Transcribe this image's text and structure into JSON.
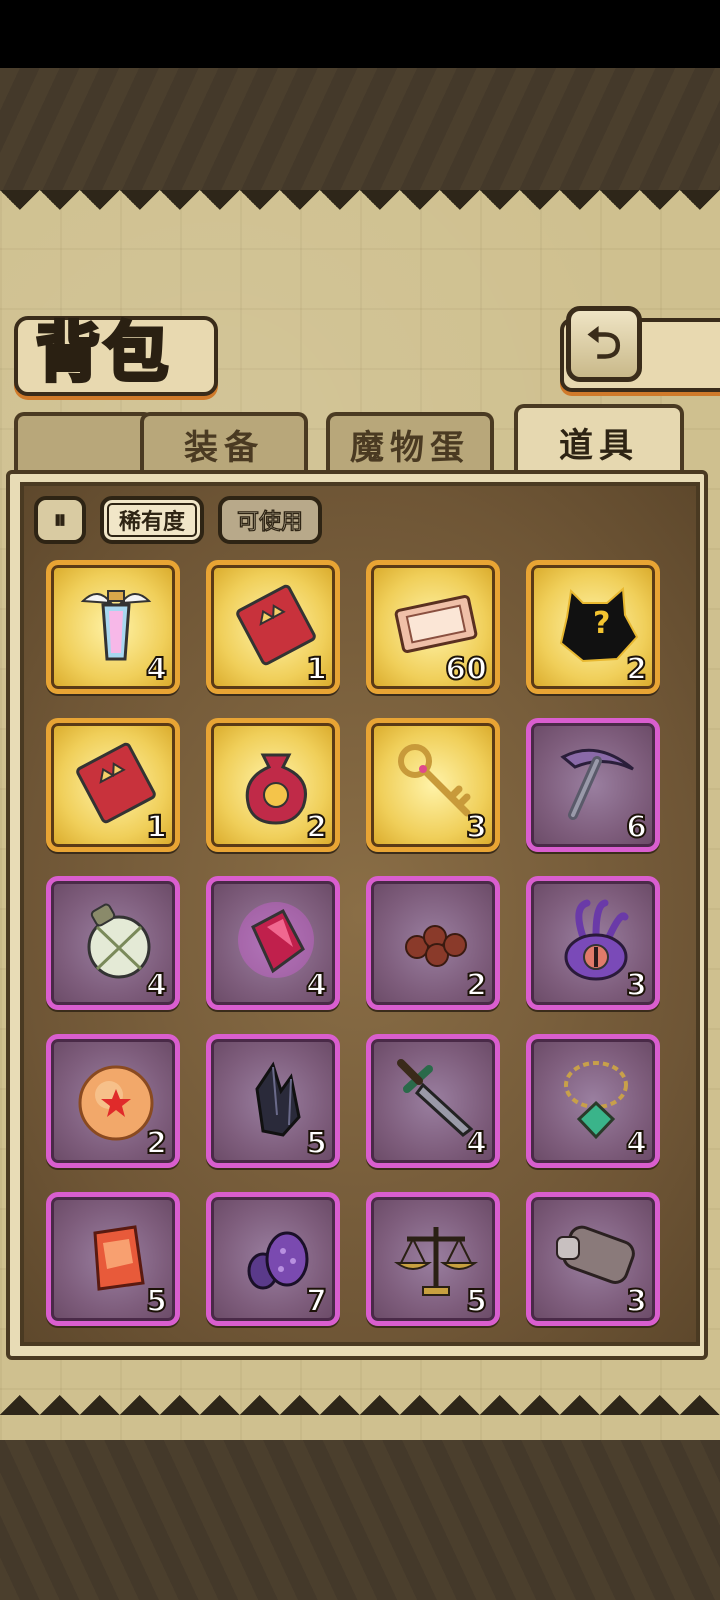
{
  "header": {
    "title": "背包",
    "back_icon": "⮌"
  },
  "tabs": [
    {
      "label": "装备",
      "active": false
    },
    {
      "label": "魔物蛋",
      "active": false
    },
    {
      "label": "道具",
      "active": true
    }
  ],
  "filters": {
    "sort_icon": "⏸",
    "rarity_label": "稀有度",
    "usable_label": "可使用"
  },
  "colors": {
    "gold_rarity": "#e8a434",
    "purple_rarity": "#d95ecf",
    "parchment": "#cfc08f"
  },
  "items": [
    {
      "icon": "winged-lantern-icon",
      "rarity": "gold",
      "count": "4"
    },
    {
      "icon": "anniversary-red-envelope-icon",
      "rarity": "gold",
      "count": "1"
    },
    {
      "icon": "ticket-icon",
      "rarity": "gold",
      "count": "60"
    },
    {
      "icon": "mystery-silhouette-icon",
      "rarity": "gold",
      "count": "2"
    },
    {
      "icon": "anniversary-red-envelope-icon",
      "rarity": "gold",
      "count": "1"
    },
    {
      "icon": "lucky-bag-icon",
      "rarity": "gold",
      "count": "2"
    },
    {
      "icon": "golden-key-icon",
      "rarity": "gold",
      "count": "3"
    },
    {
      "icon": "pickaxe-icon",
      "rarity": "purple",
      "count": "6"
    },
    {
      "icon": "glass-lantern-icon",
      "rarity": "purple",
      "count": "4"
    },
    {
      "icon": "red-crystal-icon",
      "rarity": "purple",
      "count": "4"
    },
    {
      "icon": "brown-seeds-icon",
      "rarity": "purple",
      "count": "2"
    },
    {
      "icon": "tentacle-eye-icon",
      "rarity": "purple",
      "count": "3"
    },
    {
      "icon": "star-orb-icon",
      "rarity": "purple",
      "count": "2"
    },
    {
      "icon": "dark-crystal-icon",
      "rarity": "purple",
      "count": "5"
    },
    {
      "icon": "broken-sword-icon",
      "rarity": "purple",
      "count": "4"
    },
    {
      "icon": "jade-amulet-icon",
      "rarity": "purple",
      "count": "4"
    },
    {
      "icon": "fire-stone-icon",
      "rarity": "purple",
      "count": "5"
    },
    {
      "icon": "purple-eggs-icon",
      "rarity": "purple",
      "count": "7"
    },
    {
      "icon": "scales-icon",
      "rarity": "purple",
      "count": "5"
    },
    {
      "icon": "metal-scroll-icon",
      "rarity": "purple",
      "count": "3"
    }
  ]
}
